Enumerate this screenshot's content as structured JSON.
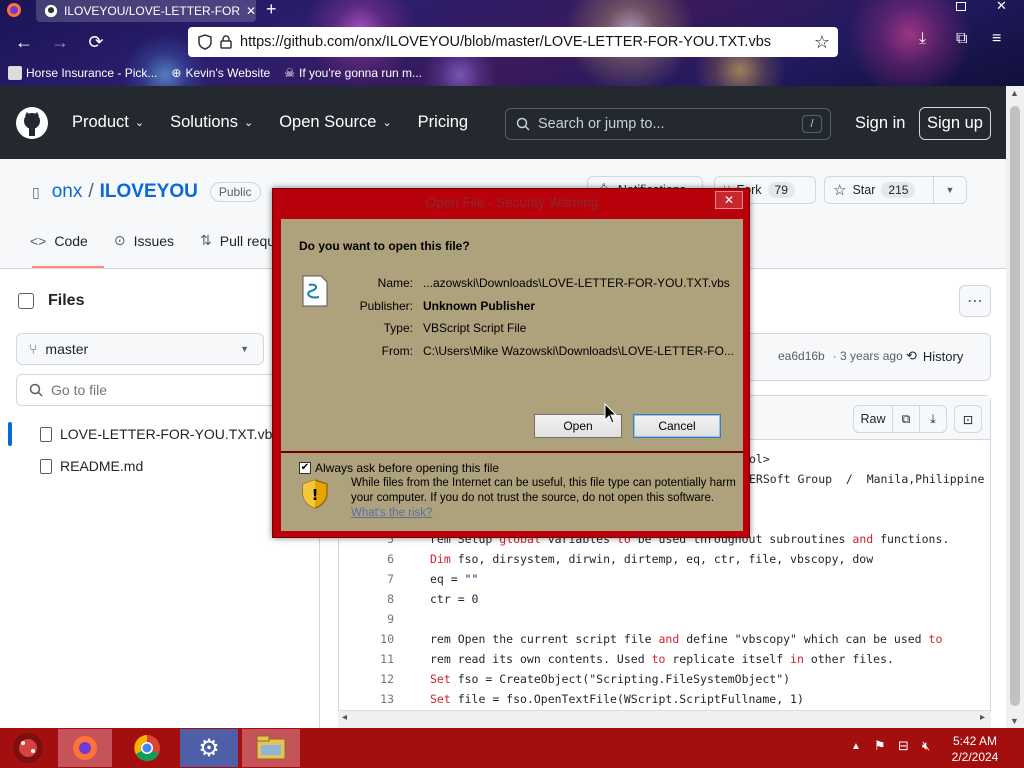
{
  "browser": {
    "tab_title": "ILOVEYOU/LOVE-LETTER-FOR-",
    "new_tab": "+",
    "url": "https://github.com/onx/ILOVEYOU/blob/master/LOVE-LETTER-FOR-YOU.TXT.vbs",
    "bookmarks": [
      {
        "label": "Horse Insurance - Pick..."
      },
      {
        "label": "Kevin's Website"
      },
      {
        "label": "If you're gonna run m..."
      }
    ]
  },
  "github": {
    "nav": [
      "Product",
      "Solutions",
      "Open Source",
      "Pricing"
    ],
    "search_placeholder": "Search or jump to...",
    "search_key": "/",
    "sign_in": "Sign in",
    "sign_up": "Sign up"
  },
  "repo": {
    "owner": "onx",
    "separator": "/",
    "name": "ILOVEYOU",
    "visibility": "Public",
    "notifications_label": "Notifications",
    "fork_label": "Fork",
    "fork_count": "79",
    "star_label": "Star",
    "star_count": "215",
    "tabs": [
      "Code",
      "Issues",
      "Pull requests"
    ]
  },
  "sidebar": {
    "title": "Files",
    "branch": "master",
    "goto_placeholder": "Go to file",
    "files": [
      "LOVE-LETTER-FOR-YOU.TXT.vbs",
      "README.md"
    ]
  },
  "commit": {
    "hash": "ea6d16b",
    "age": "· 3 years ago",
    "history": "History"
  },
  "code_toolbar": {
    "raw": "Raw"
  },
  "code": {
    "partial_top": [
      "ol>",
      "ERSoft Group  /  Manila,Philippine"
    ],
    "lines": [
      {
        "n": "5",
        "segs": [
          [
            "rem Setup ",
            ""
          ],
          [
            "global",
            "kw"
          ],
          [
            " variables ",
            ""
          ],
          [
            "to",
            "kw"
          ],
          [
            " be used throughout subroutines ",
            ""
          ],
          [
            "and",
            "kw"
          ],
          [
            " functions.",
            ""
          ]
        ]
      },
      {
        "n": "6",
        "segs": [
          [
            "Dim",
            "kw"
          ],
          [
            " fso, dirsystem, dirwin, dirtemp, eq, ctr, file, vbscopy, dow",
            ""
          ]
        ]
      },
      {
        "n": "7",
        "segs": [
          [
            "eq = ",
            ""
          ],
          [
            "\"\"",
            "st"
          ]
        ]
      },
      {
        "n": "8",
        "segs": [
          [
            "ctr = 0",
            ""
          ]
        ]
      },
      {
        "n": "9",
        "segs": [
          [
            "",
            ""
          ]
        ]
      },
      {
        "n": "10",
        "segs": [
          [
            "rem Open the current script file ",
            ""
          ],
          [
            "and",
            "kw"
          ],
          [
            " define \"vbscopy\" which can be used ",
            ""
          ],
          [
            "to",
            "kw"
          ]
        ]
      },
      {
        "n": "11",
        "segs": [
          [
            "rem read its own contents. Used ",
            ""
          ],
          [
            "to",
            "kw"
          ],
          [
            " replicate itself ",
            ""
          ],
          [
            "in",
            "kw"
          ],
          [
            " other files.",
            ""
          ]
        ]
      },
      {
        "n": "12",
        "segs": [
          [
            "Set",
            "kw"
          ],
          [
            " fso = CreateObject(\"Scripting.FileSystemObject\")",
            ""
          ]
        ]
      },
      {
        "n": "13",
        "segs": [
          [
            "Set",
            "kw"
          ],
          [
            " file = fso.OpenTextFile(WScript.ScriptFullname, 1)",
            ""
          ]
        ]
      }
    ]
  },
  "dialog": {
    "title": "Open File - Security Warning",
    "close": "✕",
    "question": "Do you want to open this file?",
    "fields": [
      {
        "label": "Name:",
        "value": "...azowski\\Downloads\\LOVE-LETTER-FOR-YOU.TXT.vbs",
        "bold": false
      },
      {
        "label": "Publisher:",
        "value": "Unknown Publisher",
        "bold": true
      },
      {
        "label": "Type:",
        "value": "VBScript Script File",
        "bold": false
      },
      {
        "label": "From:",
        "value": "C:\\Users\\Mike Wazowski\\Downloads\\LOVE-LETTER-FO...",
        "bold": false
      }
    ],
    "open_button": "Open",
    "cancel_button": "Cancel",
    "always_ask": "Always ask before opening this file",
    "always_ask_checked": true,
    "warning": "While files from the Internet can be useful, this file type can potentially harm your computer. If you do not trust the source, do not open this software.",
    "warning_link": "What's the risk?"
  },
  "taskbar": {
    "time": "5:42 AM",
    "date": "2/2/2024"
  },
  "colors": {
    "github_header": "#24292f",
    "dialog_frame": "#b8010b",
    "dialog_body": "#aea27d",
    "taskbar": "#a30f0f",
    "link": "#0969da"
  }
}
